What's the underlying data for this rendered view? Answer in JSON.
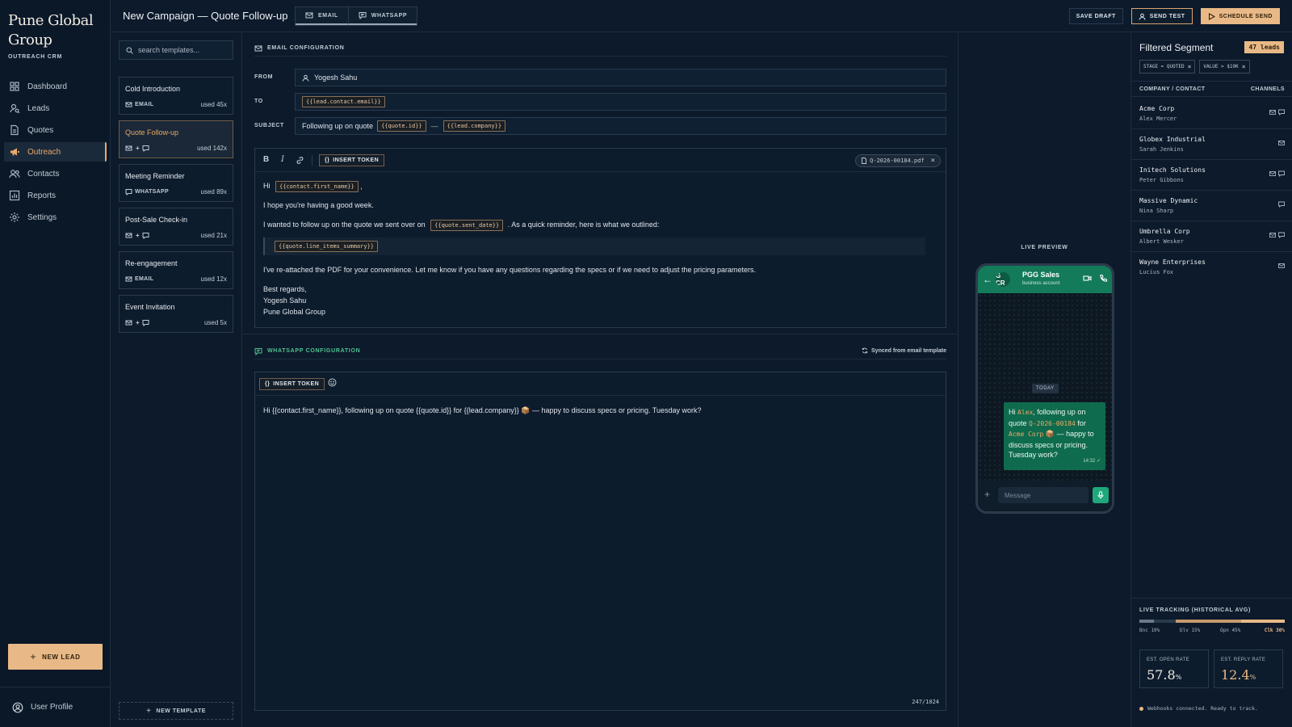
{
  "brand": {
    "name_line1": "Pune Global",
    "name_line2": "Group",
    "subtitle": "OUTREACH CRM"
  },
  "nav": [
    {
      "label": "Dashboard",
      "icon": "grid-icon"
    },
    {
      "label": "Leads",
      "icon": "user-search-icon"
    },
    {
      "label": "Quotes",
      "icon": "document-icon"
    },
    {
      "label": "Outreach",
      "icon": "megaphone-icon",
      "active": true
    },
    {
      "label": "Contacts",
      "icon": "users-icon"
    },
    {
      "label": "Reports",
      "icon": "chart-icon"
    },
    {
      "label": "Settings",
      "icon": "gear-icon"
    }
  ],
  "sidebar": {
    "new_lead": "NEW LEAD",
    "user_profile": "User Profile"
  },
  "header": {
    "title": "New Campaign — Quote Follow-up",
    "tabs": [
      "EMAIL",
      "WHATSAPP"
    ],
    "save_draft": "SAVE DRAFT",
    "send_test": "SEND TEST",
    "schedule_send": "SCHEDULE SEND"
  },
  "templates": {
    "search_placeholder": "search templates...",
    "items": [
      {
        "name": "Cold Introduction",
        "channel": "EMAIL",
        "used": "used 45x"
      },
      {
        "name": "Quote Follow-up",
        "channel": "+",
        "used": "used 142x",
        "active": true
      },
      {
        "name": "Meeting Reminder",
        "channel": "WHATSAPP",
        "used": "used 89x"
      },
      {
        "name": "Post-Sale Check-in",
        "channel": "+",
        "used": "used 21x"
      },
      {
        "name": "Re-engagement",
        "channel": "EMAIL",
        "used": "used 12x"
      },
      {
        "name": "Event Invitation",
        "channel": "+",
        "used": "used 5x"
      }
    ],
    "new_template": "NEW TEMPLATE"
  },
  "email": {
    "section_title": "EMAIL CONFIGURATION",
    "from_label": "FROM",
    "from_value": "Yogesh Sahu",
    "to_label": "TO",
    "to_token": "{{lead.contact.email}}",
    "subject_label": "SUBJECT",
    "subject_prefix": "Following up on quote",
    "subject_token1": "{{quote.id}}",
    "subject_dash": "—",
    "subject_token2": "{{lead.company}}",
    "toolbar": {
      "bold": "B",
      "italic": "I",
      "insert_token": "INSERT TOKEN",
      "attachment": "Q-2026-00184.pdf"
    },
    "body": {
      "greeting": "Hi",
      "greeting_token": "{{contact.first_name}}",
      "greeting_end": ",",
      "line1": "I hope you're having a good week.",
      "line2_a": "I wanted to follow up on the quote we sent over on",
      "line2_token": "{{quote.sent_date}}",
      "line2_b": ". As a quick reminder, here is what we outlined:",
      "quote_token": "{{quote.line_items_summary}}",
      "line3": "I've re-attached the PDF for your convenience. Let me know if you have any questions regarding the specs or if we need to adjust the pricing parameters.",
      "signoff": "Best regards,",
      "sign_name": "Yogesh Sahu",
      "sign_company": "Pune Global Group"
    }
  },
  "whatsapp": {
    "section_title": "WHATSAPP CONFIGURATION",
    "synced": "Synced from email template",
    "insert_token": "INSERT TOKEN",
    "message": "Hi {{contact.first_name}}, following up on quote {{quote.id}} for {{lead.company}} 📦 — happy to discuss specs or pricing. Tuesday work?",
    "counter": "247/1024"
  },
  "preview": {
    "label": "LIVE PREVIEW",
    "avatar": "G CR",
    "contact_name": "PGG Sales",
    "contact_sub": "business account",
    "today": "TODAY",
    "msg_hi": "Hi",
    "msg_name": "Alex",
    "msg_part2": ", following up on quote",
    "msg_quote": "Q-2026-00184",
    "msg_for": "for",
    "msg_company": "Acme Corp",
    "msg_part3": "📦 — happy to discuss specs or pricing. Tuesday work?",
    "time": "14:32",
    "input_placeholder": "Message"
  },
  "segment": {
    "title": "Filtered Segment",
    "count": "47 leads",
    "filters": [
      "STAGE = QUOTED",
      "VALUE > $10K"
    ],
    "col_left": "COMPANY / CONTACT",
    "col_right": "CHANNELS",
    "leads": [
      {
        "company": "Acme Corp",
        "contact": "Alex Mercer",
        "channels": [
          "mail-icon",
          "chat-icon"
        ]
      },
      {
        "company": "Globex Industrial",
        "contact": "Sarah Jenkins",
        "channels": [
          "mail-icon"
        ]
      },
      {
        "company": "Initech Solutions",
        "contact": "Peter Gibbons",
        "channels": [
          "mail-icon",
          "chat-icon"
        ]
      },
      {
        "company": "Massive Dynamic",
        "contact": "Nina Sharp",
        "channels": [
          "chat-icon"
        ]
      },
      {
        "company": "Umbrella Corp",
        "contact": "Albert Wesker",
        "channels": [
          "mail-icon",
          "chat-icon"
        ]
      },
      {
        "company": "Wayne Enterprises",
        "contact": "Lucius Fox",
        "channels": [
          "mail-icon"
        ]
      }
    ]
  },
  "tracking": {
    "title": "LIVE TRACKING (HISTORICAL AVG)",
    "funnel": [
      {
        "label": "Bnc 10%",
        "value": 10,
        "color": "#6b7a8a"
      },
      {
        "label": "Dlv 15%",
        "value": 15,
        "color": "#2a3a4d"
      },
      {
        "label": "Opn 45%",
        "value": 45,
        "color": "#c49a6c"
      },
      {
        "label": "Clk 30%",
        "value": 30,
        "color": "#e8b986"
      }
    ],
    "open_rate_label": "EST. OPEN RATE",
    "open_rate": "57.8",
    "reply_rate_label": "EST. REPLY RATE",
    "reply_rate": "12.4",
    "unit": "%",
    "webhook": "Webhooks connected. Ready to track."
  },
  "colors": {
    "accent": "#e8b986",
    "whatsapp_green": "#137a5a",
    "background": "#0c1a2b"
  }
}
